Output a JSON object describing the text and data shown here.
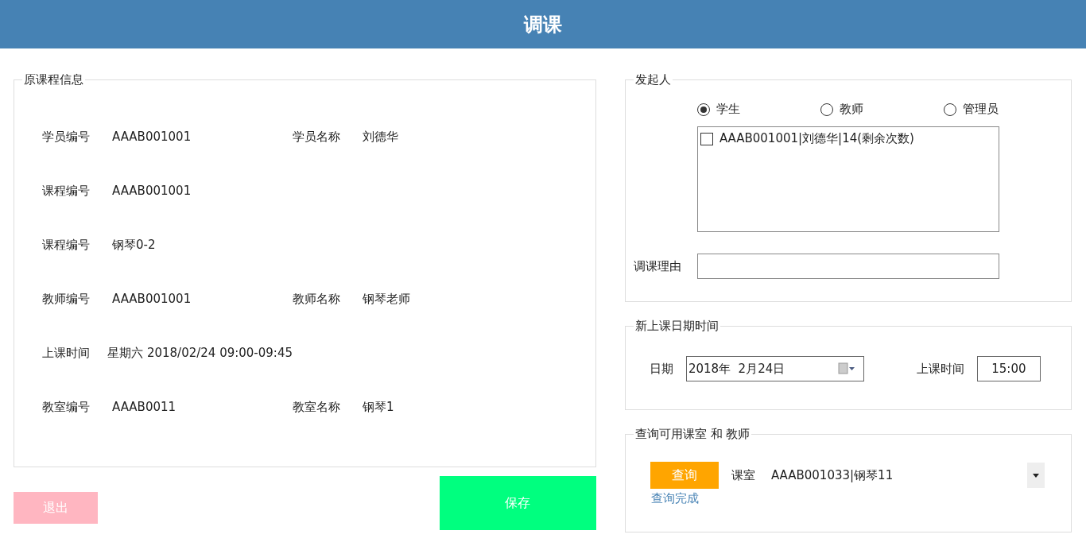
{
  "window": {
    "title": "调课"
  },
  "original_course": {
    "title": "原课程信息",
    "rows": [
      {
        "fields": [
          {
            "label": "学员编号",
            "value": "AAAB001001"
          },
          {
            "label": "学员名称",
            "value": "刘德华"
          }
        ]
      },
      {
        "fields": [
          {
            "label": "课程编号",
            "value": "AAAB001001"
          }
        ]
      },
      {
        "fields": [
          {
            "label": "课程编号",
            "value": "钢琴0-2"
          }
        ]
      },
      {
        "fields": [
          {
            "label": "教师编号",
            "value": "AAAB001001"
          },
          {
            "label": "教师名称",
            "value": "钢琴老师"
          }
        ]
      },
      {
        "fields": [
          {
            "label": "上课时间",
            "value": "星期六 2018/02/24 09:00-09:45"
          }
        ]
      },
      {
        "fields": [
          {
            "label": "教室编号",
            "value": "AAAB0011"
          },
          {
            "label": "教室名称",
            "value": "钢琴1"
          }
        ]
      }
    ]
  },
  "initiator": {
    "title": "发起人",
    "options": [
      {
        "label": "学生",
        "selected": true
      },
      {
        "label": "教师",
        "selected": false
      },
      {
        "label": "管理员",
        "selected": false
      }
    ],
    "list_items": [
      {
        "label": "AAAB001001|刘德华|14(剩余次数)",
        "checked": false
      }
    ],
    "reason_label": "调课理由"
  },
  "new_time": {
    "title": "新上课日期时间",
    "date_label": "日期",
    "date_value": "2018年  2月24日",
    "time_label": "上课时间",
    "time_value": "15:00"
  },
  "query": {
    "title": "查询可用课室 和 教师",
    "button": "查询",
    "room_label": "课室",
    "room_value": "AAAB001033|钢琴11",
    "status": "查询完成"
  },
  "buttons": {
    "exit": "退出",
    "save": "保存"
  }
}
